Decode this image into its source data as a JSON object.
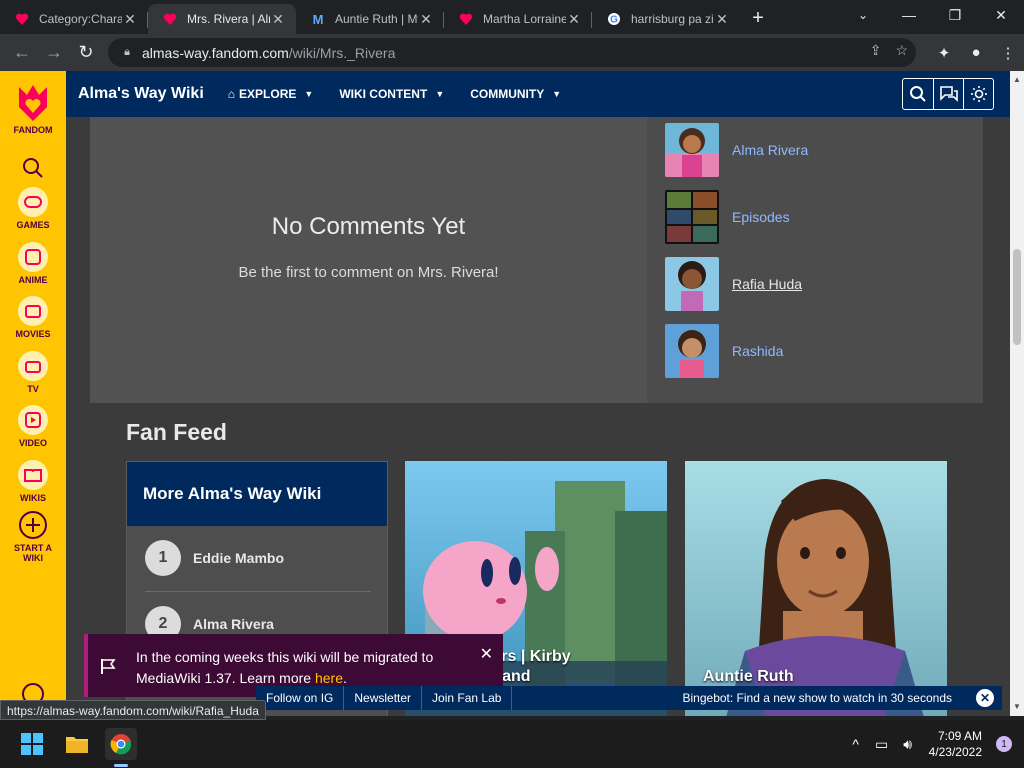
{
  "browser": {
    "tabs": [
      {
        "title": "Category:Characters",
        "favicon": "fandom-heart-icon",
        "active": false
      },
      {
        "title": "Mrs. Rivera | Alma's Way Wiki",
        "favicon": "fandom-heart-icon",
        "active": true
      },
      {
        "title": "Auntie Ruth | Mya",
        "favicon": "m-logo-icon",
        "active": false
      },
      {
        "title": "Martha Lorraine",
        "favicon": "fandom-heart-icon",
        "active": false
      },
      {
        "title": "harrisburg pa zip",
        "favicon": "google-icon",
        "active": false
      }
    ],
    "url_host": "almas-way.fandom.com",
    "url_path": "/wiki/Mrs._Rivera",
    "status_url": "https://almas-way.fandom.com/wiki/Rafia_Huda"
  },
  "rail": {
    "brand": "FANDOM",
    "items": [
      "GAMES",
      "ANIME",
      "MOVIES",
      "TV",
      "VIDEO",
      "WIKIS"
    ],
    "start_line1": "START A",
    "start_line2": "WIKI"
  },
  "header": {
    "site_name": "Alma's Way Wiki",
    "nav": [
      "EXPLORE",
      "WIKI CONTENT",
      "COMMUNITY"
    ]
  },
  "comments": {
    "title": "No Comments Yet",
    "subtitle": "Be the first to comment on Mrs. Rivera!"
  },
  "related": [
    "Alma Rivera",
    "Episodes",
    "Rafia Huda",
    "Rashida"
  ],
  "fanfeed": {
    "title": "Fan Feed",
    "more_header": "More Alma's Way Wiki",
    "ranks": [
      {
        "num": "1",
        "name": "Eddie Mambo"
      },
      {
        "num": "2",
        "name": "Alma Rivera"
      }
    ],
    "card2_caption_l1": "ame Trailers | Kirby",
    "card2_caption_l2": "orgotten Land",
    "card3_caption": "Auntie Ruth"
  },
  "notice": {
    "text": "In the coming weeks this wiki will be migrated to MediaWiki 1.37. Learn more ",
    "link": "here",
    "end": "."
  },
  "bottombar": {
    "links": [
      "Follow on IG",
      "Newsletter",
      "Join Fan Lab"
    ],
    "bingebot": "Bingebot: Find a new show to watch in 30 seconds"
  },
  "taskbar": {
    "time": "7:09 AM",
    "date": "4/23/2022",
    "notifications": "1"
  },
  "colors": {
    "fandom_yellow": "#ffc500",
    "wiki_navy": "#002a5e",
    "link_blue": "#8fb9ff"
  }
}
